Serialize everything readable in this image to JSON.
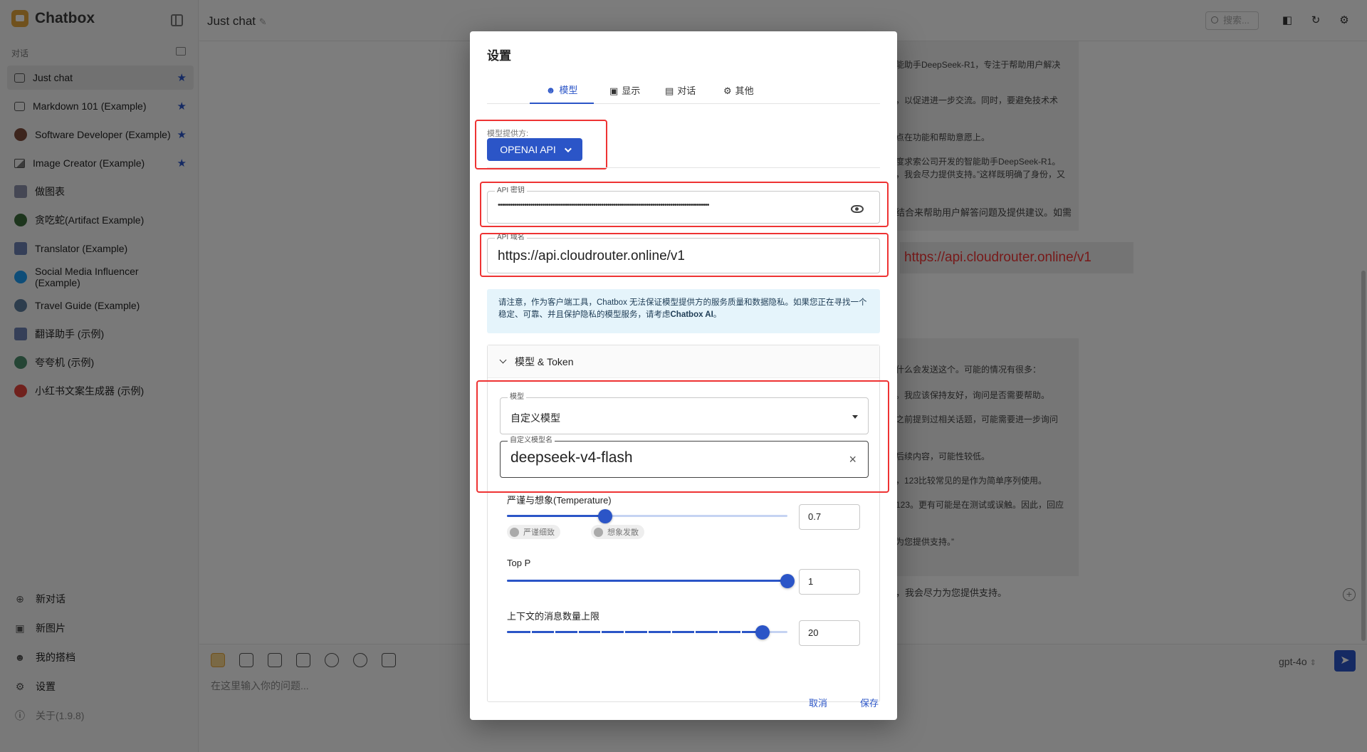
{
  "app": {
    "name": "Chatbox"
  },
  "sidebar": {
    "section_label": "对话",
    "items": [
      {
        "label": "Just chat",
        "icon": "chat-bubble-icon",
        "starred": true,
        "active": true
      },
      {
        "label": "Markdown 101 (Example)",
        "icon": "chat-bubble-icon",
        "starred": true
      },
      {
        "label": "Software Developer (Example)",
        "icon": "avatar-icon",
        "starred": true
      },
      {
        "label": "Image Creator (Example)",
        "icon": "image-icon",
        "starred": true
      },
      {
        "label": "做图表",
        "icon": "avatar-icon"
      },
      {
        "label": "贪吃蛇(Artifact Example)",
        "icon": "avatar-icon"
      },
      {
        "label": "Translator (Example)",
        "icon": "avatar-icon"
      },
      {
        "label": "Social Media Influencer (Example)",
        "icon": "twitter-icon"
      },
      {
        "label": "Travel Guide (Example)",
        "icon": "avatar-icon"
      },
      {
        "label": "翻译助手 (示例)",
        "icon": "avatar-icon"
      },
      {
        "label": "夸夸机 (示例)",
        "icon": "avatar-icon"
      },
      {
        "label": "小红书文案生成器 (示例)",
        "icon": "avatar-icon"
      }
    ],
    "bottom": {
      "new_chat": "新对话",
      "new_image": "新图片",
      "my_partners": "我的搭档",
      "settings": "设置",
      "about": "关于(1.9.8)"
    }
  },
  "topbar": {
    "chat_title": "Just chat",
    "search_placeholder": "搜索..."
  },
  "chat": {
    "bg_lines": [
      "能助手DeepSeek-R1，专注于帮助用户解决",
      "，以促进进一步交流。同时，要避免技术术",
      "点在功能和帮助意愿上。",
      "度求索公司开发的智能助手DeepSeek-R1。",
      "，我会尽力提供支持。”这样既明确了身份，又",
      "结合来帮助用户解答问题及提供建议。如需",
      "什么会发送这个。可能的情况有很多：",
      "。我应该保持友好，询问是否需要帮助。",
      "之前提到过相关话题，可能需要进一步询问",
      "后续内容，可能性较低。",
      "，123比较常见的是作为简单序列使用。",
      "123。更有可能是在测试或误触。因此，回应",
      "为您提供支持。”",
      "，我会尽力为您提供支持。"
    ],
    "url_echo": "https://api.cloudrouter.online/v1"
  },
  "composer": {
    "placeholder": "在这里输入你的问题...",
    "model": "gpt-4o"
  },
  "settings_dialog": {
    "title": "设置",
    "tabs": [
      "模型",
      "显示",
      "对话",
      "其他"
    ],
    "active_tab": "模型",
    "provider_label": "模型提供方:",
    "provider_value": "OPENAI API",
    "api_key_label": "API 密钥",
    "api_key_value": "••••••••••••••••••••••••••••••••••••••••••••••••••••••••••••••••••••••••••••••••••••••••••••••••••••••••",
    "api_host_label": "API 域名",
    "api_host_value": "https://api.cloudrouter.online/v1",
    "notice_text_1": "请注意，作为客户端工具，Chatbox 无法保证模型提供方的服务质量和数据隐私。如果您正在寻找一个稳定、可靠、并且保护隐私的模型服务，请考虑",
    "notice_link": "Chatbox AI",
    "notice_end": "。",
    "accordion_title": "模型 & Token",
    "model_label": "模型",
    "model_value": "自定义模型",
    "custom_model_label": "自定义模型名",
    "custom_model_value": "deepseek-v4-flash",
    "temperature": {
      "label": "严谨与想象(Temperature)",
      "value": "0.7",
      "fraction": 0.35,
      "chip_left": "严谨细致",
      "chip_right": "想象发散"
    },
    "top_p": {
      "label": "Top P",
      "value": "1",
      "fraction": 1.0
    },
    "context_limit": {
      "label": "上下文的消息数量上限",
      "value": "20",
      "fraction": 0.91
    },
    "cancel_label": "取消",
    "save_label": "保存"
  },
  "colors": {
    "accent": "#2b55c7",
    "highlight_box": "#e33333",
    "notice_bg": "#e5f4fb"
  }
}
